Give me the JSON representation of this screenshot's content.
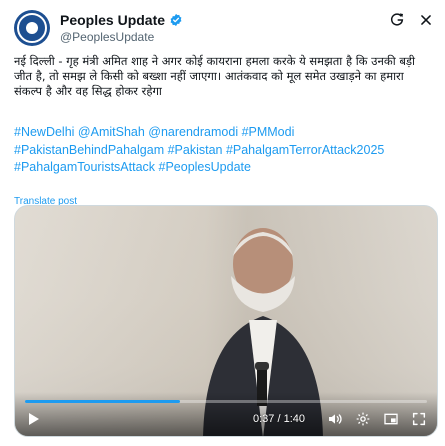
{
  "author": {
    "display_name": "Peoples Update",
    "handle": "@PeoplesUpdate",
    "verified": true
  },
  "header_icons": [
    "grok-icon",
    "close-icon"
  ],
  "post_text": "नई दिल्ली - गृह मंत्री अमित शाह ने अगर कोई कायराना हमला करके ये समझता है कि उनकी बड़ी जीत है, तो समझ ले किसी को बख्शा नहीं जाएगा। आतंकवाद को मूल समेत उखाड़ने का हमारा संकल्प है और वह सिद्ध होकर रहेगा",
  "hashtags": "#NewDelhi @AmitShah @narendramodi #PMModi #PakistanBehindPahalgam #Pakistan #PahalgamTerrorAttack2025 #PahalgamTouristsAttack #PeoplesUpdate",
  "translate_label": "Translate post",
  "video": {
    "time": "0:37 / 1:40",
    "progress_fraction": 0.385,
    "icons": [
      "play-icon",
      "volume-icon",
      "settings-icon",
      "picture-in-picture-icon",
      "fullscreen-icon"
    ]
  },
  "colors": {
    "accent": "#1d9bf0",
    "text": "#0f1419",
    "muted": "#536471",
    "avatar": "#1d4f91"
  }
}
